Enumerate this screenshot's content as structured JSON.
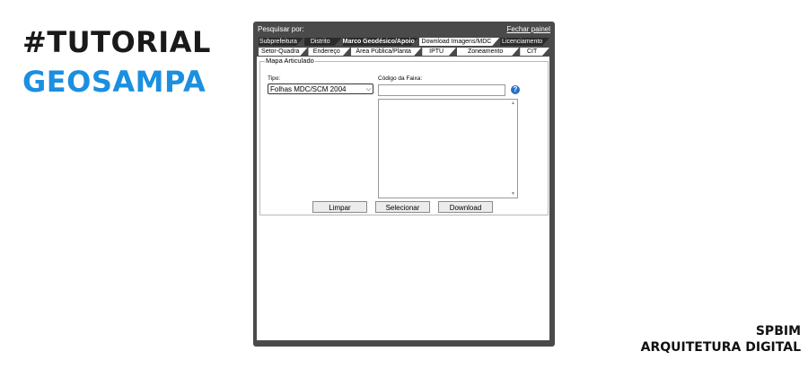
{
  "branding": {
    "line1": "#TUTORIAL",
    "line2": "GEOSAMPA",
    "accent": "#1b8fe0"
  },
  "credit": {
    "line1": "SPBIM",
    "line2": "ARQUITETURA DIGITAL"
  },
  "panel": {
    "title": "Pesquisar por:",
    "close_label": "Fechar painel",
    "tabs_row1": [
      {
        "label": "Subprefeitura"
      },
      {
        "label": "Distrito"
      },
      {
        "label": "Marco Geodésico/Apoio"
      },
      {
        "label": "Download Imagens/MDC",
        "active": true
      },
      {
        "label": "Licenciamento"
      }
    ],
    "tabs_row2": [
      {
        "label": "Setor-Quadra"
      },
      {
        "label": "Endereço"
      },
      {
        "label": "Área Pública/Planta"
      },
      {
        "label": "IPTU"
      },
      {
        "label": "Zoneamento"
      },
      {
        "label": "CIT"
      }
    ],
    "section": {
      "legend": "Mapa Articulado",
      "tipo_label": "Tipo:",
      "tipo_value": "Folhas MDC/SCM 2004",
      "codigo_label": "Código da Faixa:",
      "help_icon": "info-icon"
    },
    "buttons": {
      "clear": "Limpar",
      "select": "Selecionar",
      "download": "Download"
    }
  }
}
